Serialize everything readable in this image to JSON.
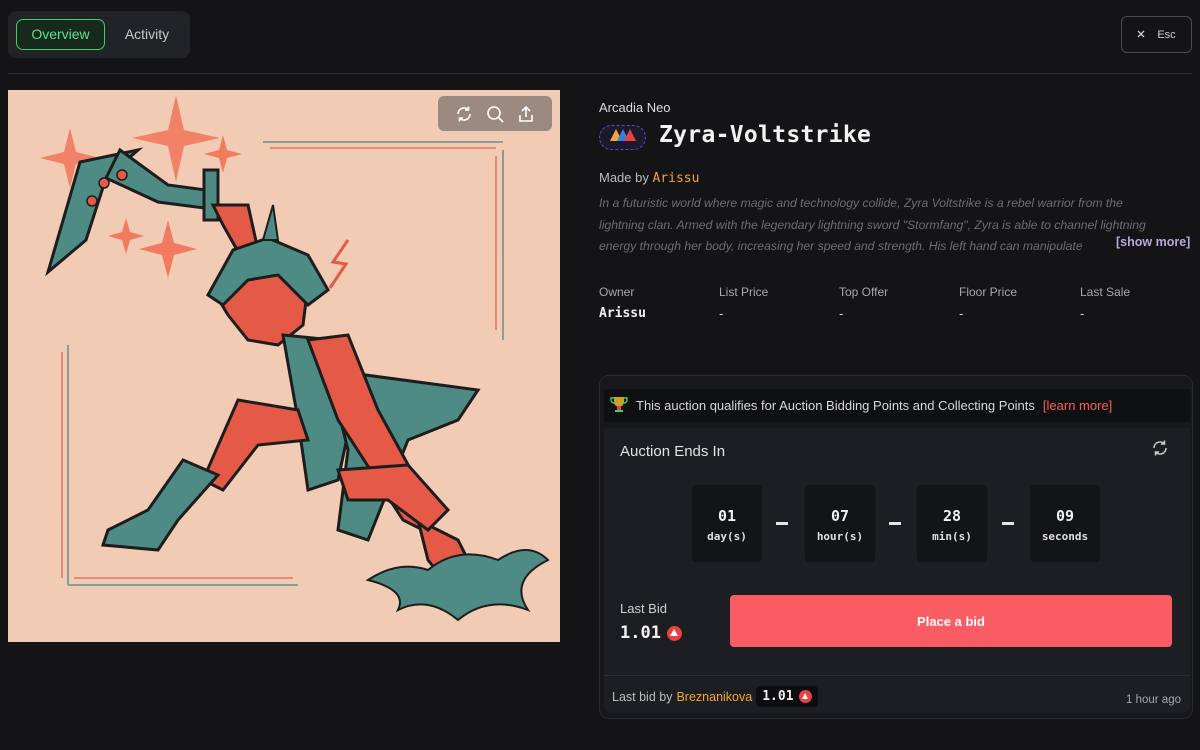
{
  "tabs": [
    {
      "label": "Overview",
      "active": true
    },
    {
      "label": "Activity",
      "active": false
    }
  ],
  "close_button": {
    "icon": "close-icon",
    "label": "Esc"
  },
  "artwork": {
    "tools": [
      "refresh-icon",
      "zoom-icon",
      "share-icon"
    ]
  },
  "nft": {
    "collection": "Arcadia Neo",
    "chain_badge_icon": "avalanche-logo-icon",
    "title": "Zyra-Voltstrike",
    "made_by_label": "Made by",
    "creator": "Arissu",
    "description_lines": [
      "In a futuristic world where magic and technology collide, Zyra Voltstrike is a rebel warrior from the",
      "lightning clan. Armed with the legendary lightning sword \"Stormfang\", Zyra is able to channel lightning",
      "energy through her body, increasing her speed and strength. His left hand can manipulate"
    ],
    "show_more": "[show more]"
  },
  "stats": [
    {
      "label": "Owner",
      "value": "Arissu"
    },
    {
      "label": "List Price",
      "value": "-"
    },
    {
      "label": "Top Offer",
      "value": "-"
    },
    {
      "label": "Floor Price",
      "value": "-"
    },
    {
      "label": "Last Sale",
      "value": "-"
    }
  ],
  "auction": {
    "notice": "This auction qualifies for Auction Bidding Points and Collecting Points",
    "notice_link": "[learn more]",
    "ends_title": "Auction Ends In",
    "countdown": [
      {
        "value": "01",
        "unit": "day(s)"
      },
      {
        "value": "07",
        "unit": "hour(s)"
      },
      {
        "value": "28",
        "unit": "min(s)"
      },
      {
        "value": "09",
        "unit": "seconds"
      }
    ],
    "last_bid_label": "Last Bid",
    "last_bid_value": "1.01",
    "place_bid_label": "Place a bid",
    "footer": {
      "prefix": "Last bid by",
      "bidder": "Breznanikova",
      "amount": "1.01",
      "time": "1 hour ago"
    }
  },
  "colors": {
    "accent_green": "#3ccf6b",
    "bid_button": "#fa5c64",
    "creator_orange": "#f0a63a",
    "link_red": "#ff5a5a"
  }
}
